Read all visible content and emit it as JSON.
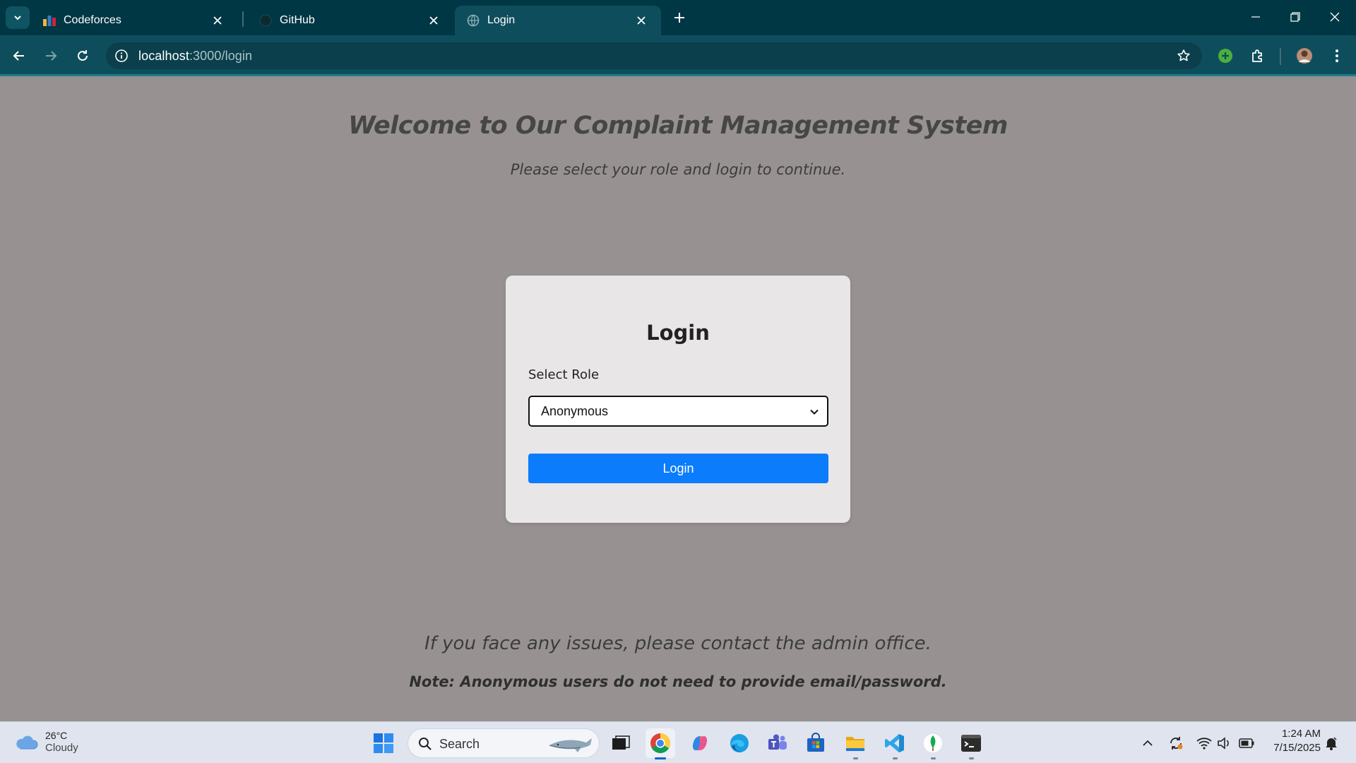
{
  "browser": {
    "tabs": [
      {
        "title": "Codeforces",
        "active": false
      },
      {
        "title": "GitHub",
        "active": false
      },
      {
        "title": "Login",
        "active": true
      }
    ],
    "url_host": "localhost",
    "url_path": ":3000/login",
    "theme_color": "#0e4e5c"
  },
  "page": {
    "headline": "Welcome to Our Complaint Management System",
    "subheadline": "Please select your role and login to continue.",
    "login_card": {
      "title": "Login",
      "role_label": "Select Role",
      "role_selected": "Anonymous",
      "submit_label": "Login",
      "button_color": "#0a7cfc"
    },
    "contact_text": "If you face any issues, please contact the admin office.",
    "note_text": "Note: Anonymous users do not need to provide email/password."
  },
  "taskbar": {
    "weather_temp": "26°C",
    "weather_condition": "Cloudy",
    "search_placeholder": "Search",
    "clock_time": "1:24 AM",
    "clock_date": "7/15/2025"
  }
}
